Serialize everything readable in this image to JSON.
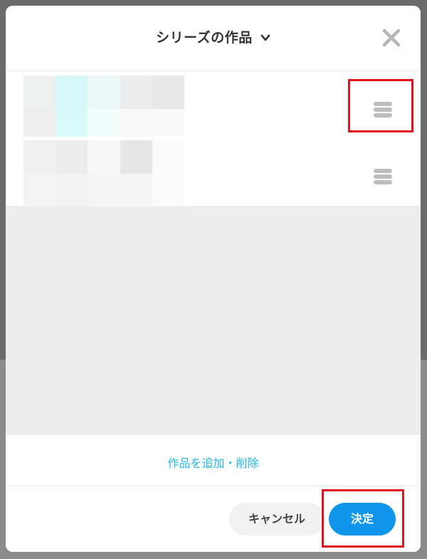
{
  "dialog": {
    "title": "シリーズの作品",
    "title_icon": "chevron-down-icon",
    "close_icon": "close-icon"
  },
  "list": {
    "items": [
      {
        "handle_icon": "drag-handle-icon",
        "thumbnail_colors": [
          "#eef0f0",
          "#d6f8f8",
          "#ecf8f8",
          "#ececec",
          "#e8e8e8",
          "#eeeeee",
          "#d9f9f9",
          "#f1fcfb",
          "#f8f8f8",
          "#f8f8f8"
        ]
      },
      {
        "handle_icon": "drag-handle-icon",
        "thumbnail_colors": [
          "#f0f0f0",
          "#ececec",
          "#f7f7f7",
          "#e6e6e6",
          "#fbfbfb",
          "#f3f3f3",
          "#f2f2f2",
          "#f5f5f5",
          "#f5f5f5",
          "#fafafa"
        ]
      }
    ]
  },
  "add_remove": {
    "label": "作品を追加・削除"
  },
  "footer": {
    "cancel_label": "キャンセル",
    "confirm_label": "決定"
  },
  "colors": {
    "accent": "#0f95ea",
    "link": "#1fb8e6",
    "highlight": "#e0141e"
  }
}
